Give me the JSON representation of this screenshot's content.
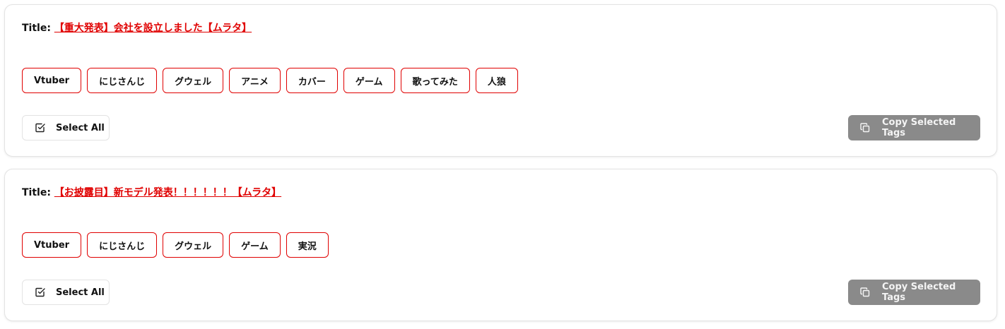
{
  "cards": [
    {
      "title_label": "Title:",
      "title": "【重大発表】会社を設立しました【ムラタ】",
      "tags": [
        "Vtuber",
        "にじさんじ",
        "グウェル",
        "アニメ",
        "カバー",
        "ゲーム",
        "歌ってみた",
        "人狼"
      ],
      "select_all_label": "Select All",
      "copy_label": "Copy Selected Tags"
    },
    {
      "title_label": "Title:",
      "title": "【お披露目】新モデル発表！！！！！！【ムラタ】",
      "tags": [
        "Vtuber",
        "にじさんじ",
        "グウェル",
        "ゲーム",
        "実況"
      ],
      "select_all_label": "Select All",
      "copy_label": "Copy Selected Tags"
    }
  ],
  "icons": {
    "select_all": "check-square-icon",
    "copy": "copy-icon"
  },
  "colors": {
    "accent": "#e00000",
    "copy_button_bg": "#8a8a8a",
    "card_border": "#e3e3e3"
  }
}
